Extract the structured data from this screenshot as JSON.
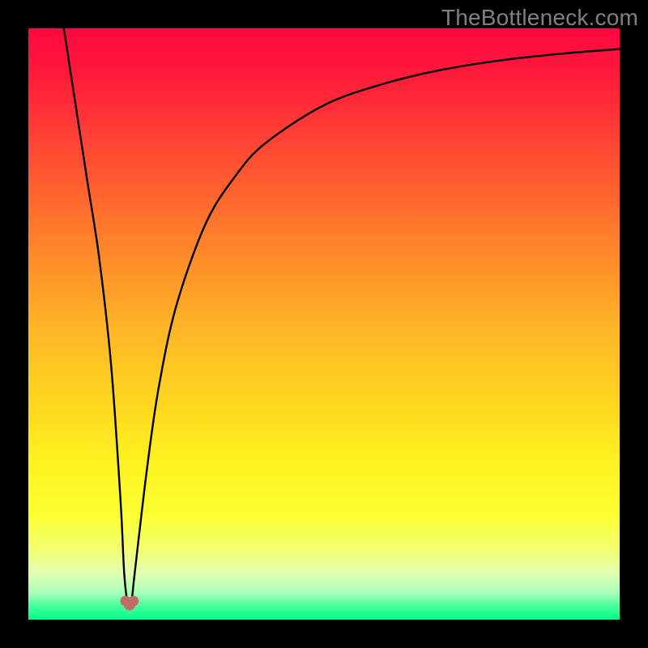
{
  "watermark": "TheBottleneck.com",
  "chart_data": {
    "type": "line",
    "title": "",
    "xlabel": "",
    "ylabel": "",
    "xlim": [
      0,
      100
    ],
    "ylim": [
      0,
      100
    ],
    "background_gradient": {
      "stops": [
        {
          "offset": 0.0,
          "color": "#ff0740"
        },
        {
          "offset": 0.08,
          "color": "#ff1b3b"
        },
        {
          "offset": 0.2,
          "color": "#ff4733"
        },
        {
          "offset": 0.35,
          "color": "#ff7e2c"
        },
        {
          "offset": 0.5,
          "color": "#ffb327"
        },
        {
          "offset": 0.62,
          "color": "#ffd321"
        },
        {
          "offset": 0.72,
          "color": "#ffef1f"
        },
        {
          "offset": 0.82,
          "color": "#fcff2f"
        },
        {
          "offset": 0.88,
          "color": "#f2ff6f"
        },
        {
          "offset": 0.92,
          "color": "#e3ffb0"
        },
        {
          "offset": 0.955,
          "color": "#a8ffbb"
        },
        {
          "offset": 0.975,
          "color": "#4dff9e"
        },
        {
          "offset": 1.0,
          "color": "#00ff88"
        }
      ]
    },
    "series": [
      {
        "name": "bottleneck-curve",
        "color": "#000000",
        "x": [
          6,
          8,
          10,
          12,
          14,
          15.6,
          16.2,
          16.8,
          17.4,
          18,
          20,
          22,
          25,
          30,
          35,
          40,
          50,
          60,
          70,
          80,
          90,
          100
        ],
        "y": [
          100,
          87,
          74,
          61,
          43,
          20,
          8,
          2.8,
          2.8,
          8,
          25,
          39,
          53,
          67,
          75,
          80.5,
          87,
          90.6,
          93,
          94.6,
          95.7,
          96.5
        ]
      }
    ],
    "marker": {
      "name": "min-point",
      "color": "#c26a6a",
      "x": 17.1,
      "y": 2.8
    }
  }
}
